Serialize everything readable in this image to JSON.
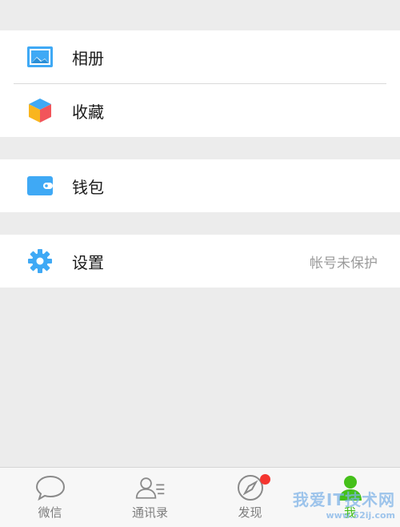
{
  "menu": {
    "group1": [
      {
        "label": "相册",
        "icon": "photo-album-icon",
        "color": "#3fa9f5"
      },
      {
        "label": "收藏",
        "icon": "favorites-cube-icon"
      }
    ],
    "group2": [
      {
        "label": "钱包",
        "icon": "wallet-icon",
        "color": "#3fa9f5"
      }
    ],
    "group3": [
      {
        "label": "设置",
        "icon": "gear-icon",
        "color": "#3fa9f5",
        "status": "帐号未保护"
      }
    ]
  },
  "tabbar": {
    "tabs": [
      {
        "label": "微信",
        "icon": "chat-bubble-icon"
      },
      {
        "label": "通讯录",
        "icon": "contacts-icon"
      },
      {
        "label": "发现",
        "icon": "compass-icon",
        "badge": true
      },
      {
        "label": "我",
        "icon": "me-person-icon",
        "active": true
      }
    ],
    "active_color": "#45c01a",
    "badge_color": "#f43530"
  },
  "watermark": {
    "text": "我爱IT技术网",
    "sub": "www.52ij.com"
  }
}
